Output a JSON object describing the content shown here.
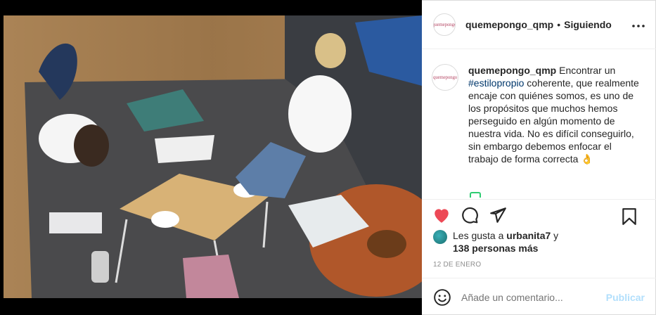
{
  "post": {
    "image_description_icon": "photo-scene"
  },
  "header": {
    "username": "quemepongo_qmp",
    "separator": "•",
    "follow_status": "Siguiendo",
    "more_icon": "more-horizontal-icon",
    "avatar_text": "quemepongo"
  },
  "caption": {
    "username": "quemepongo_qmp",
    "text_before": " Encontrar un ",
    "hashtag": "#estilopropio",
    "text_after": " coherente, que realmente encaje con quiénes somos, es uno de los propósitos que muchos hemos perseguido en algún momento de nuestra vida. No es difícil conseguirlo, sin embargo debemos enfocar el trabajo de forma correcta ",
    "emoji": "👌"
  },
  "actions": {
    "like_icon": "heart-filled-icon",
    "comment_icon": "comment-icon",
    "share_icon": "paper-plane-icon",
    "save_icon": "bookmark-icon",
    "like_color": "#ed4956"
  },
  "likes": {
    "prefix": "Les gusta a ",
    "user": "urbanita7",
    "conjunction": " y",
    "others": "138 personas más"
  },
  "date": "12 DE ENERO",
  "comment": {
    "placeholder": "Añade un comentario...",
    "post_label": "Publicar",
    "emoji_icon": "smiley-icon"
  }
}
